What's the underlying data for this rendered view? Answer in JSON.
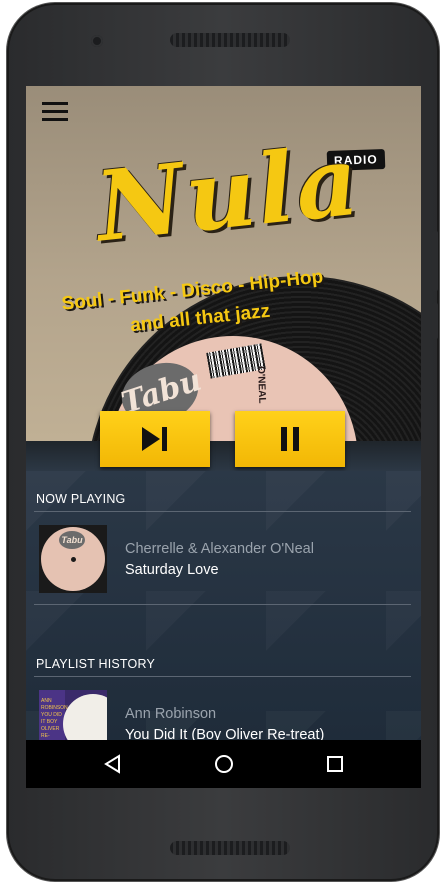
{
  "hero": {
    "radio_badge": "RADIO",
    "logo_text": "Nula",
    "tagline_line1": "Soul - Funk - Disco - Hip-Hop",
    "tagline_line2": "and all that jazz",
    "label_logo": "Tabu",
    "label_text": "O'NEAL"
  },
  "controls": {
    "skip_icon": "skip-next-icon",
    "pause_icon": "pause-icon",
    "button_color": "#f5c812"
  },
  "now_playing": {
    "title": "NOW PLAYING",
    "artist": "Cherrelle & Alexander O'Neal",
    "song": "Saturday Love",
    "cover_logo": "Tabu"
  },
  "playlist_history": {
    "title": "PLAYLIST HISTORY",
    "items": [
      {
        "artist": "Ann Robinson",
        "song": "You Did It (Boy Oliver Re-treat)",
        "cover_text": "ANN ROBINSON YOU DID IT BOY OLIVER RE-TREAT"
      }
    ]
  },
  "navigation": {
    "back_icon": "back-icon",
    "home_icon": "home-icon",
    "recents_icon": "recents-icon"
  },
  "colors": {
    "accent": "#f5c812",
    "background": "#243241",
    "text_primary": "#ffffff",
    "text_secondary": "#9aa3ad"
  }
}
